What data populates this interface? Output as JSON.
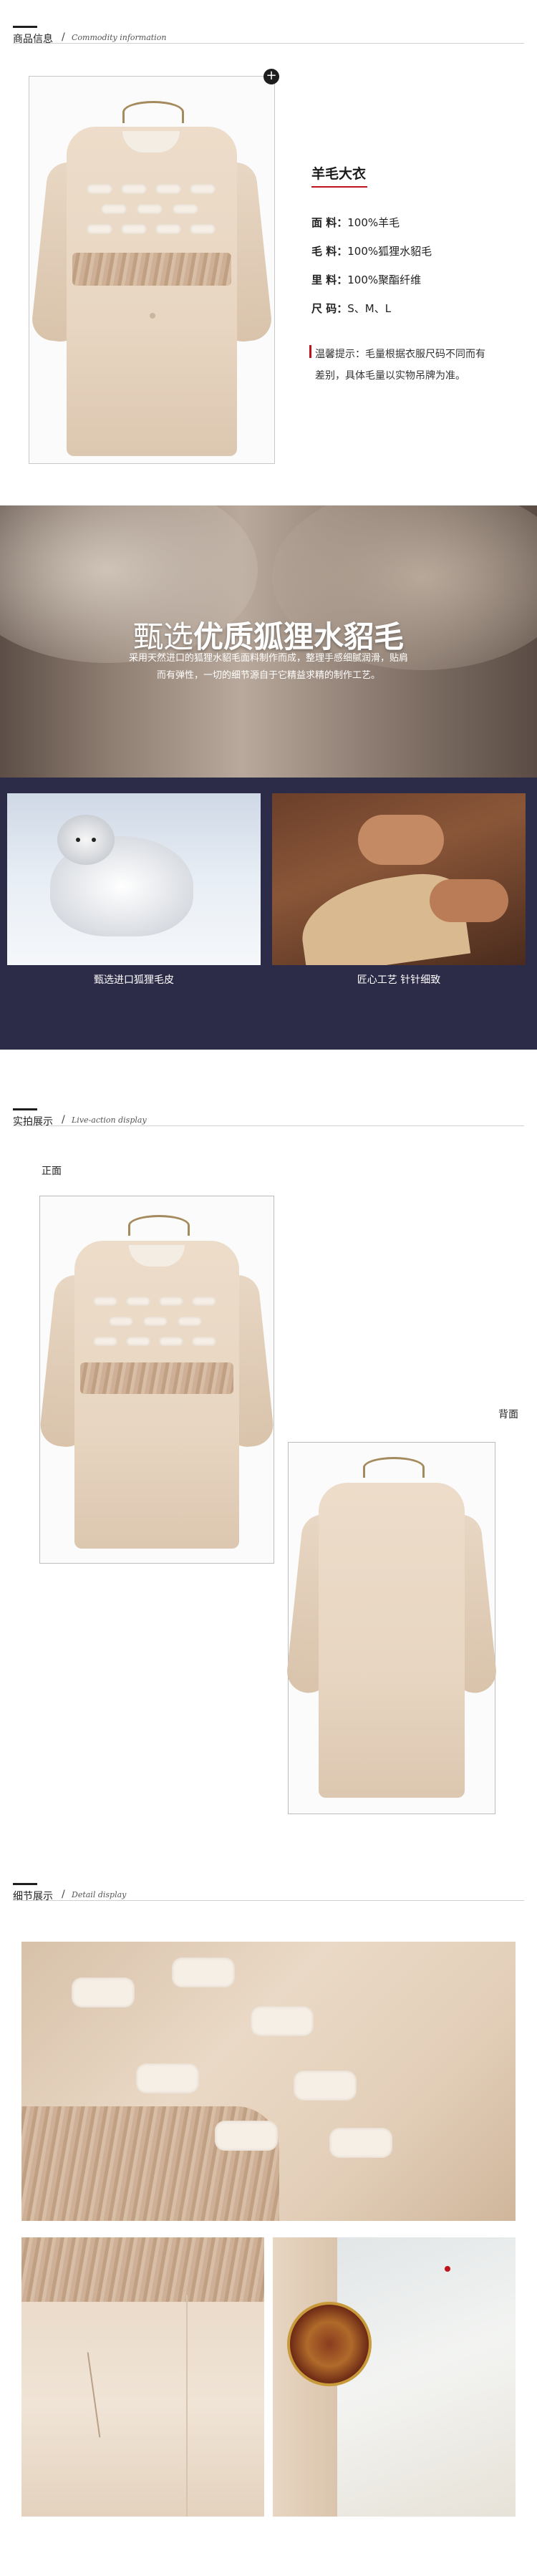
{
  "section_info": {
    "zh": "商品信息",
    "slash": "/",
    "en": "Commodity information"
  },
  "product": {
    "name": "羊毛大衣",
    "specs": [
      {
        "label": "面 料：",
        "value": "100%羊毛"
      },
      {
        "label": "毛 料：",
        "value": "100%狐狸水貂毛"
      },
      {
        "label": "里 料：",
        "value": "100%聚酯纤维"
      },
      {
        "label": "尺 码：",
        "value": "S、M、L"
      }
    ],
    "tip": "温馨提示：毛量根据衣服尺码不同而有差别，具体毛量以实物吊牌为准。"
  },
  "banner": {
    "title_plain": "甄选",
    "title_bold": "优质狐狸水貂毛",
    "desc_line1": "采用天然进口的狐狸水貂毛面料制作而成，整理手感细腻润滑，贴肩",
    "desc_line2": "而有弹性，一切的细节源自于它精益求精的制作工艺。",
    "caption_left": "甄选进口狐狸毛皮",
    "caption_right": "匠心工艺 针针细致"
  },
  "section_display": {
    "zh": "实拍展示",
    "slash": "/",
    "en": "Live-action display"
  },
  "display": {
    "front_label": "正面",
    "back_label": "背面"
  },
  "section_detail": {
    "zh": "细节展示",
    "slash": "/",
    "en": "Detail display"
  },
  "colors": {
    "band": "#2c2b48",
    "accent_red": "#c0121a",
    "coat": "#e8d6c2"
  },
  "icons": {
    "plus": "plus-circle-icon"
  }
}
